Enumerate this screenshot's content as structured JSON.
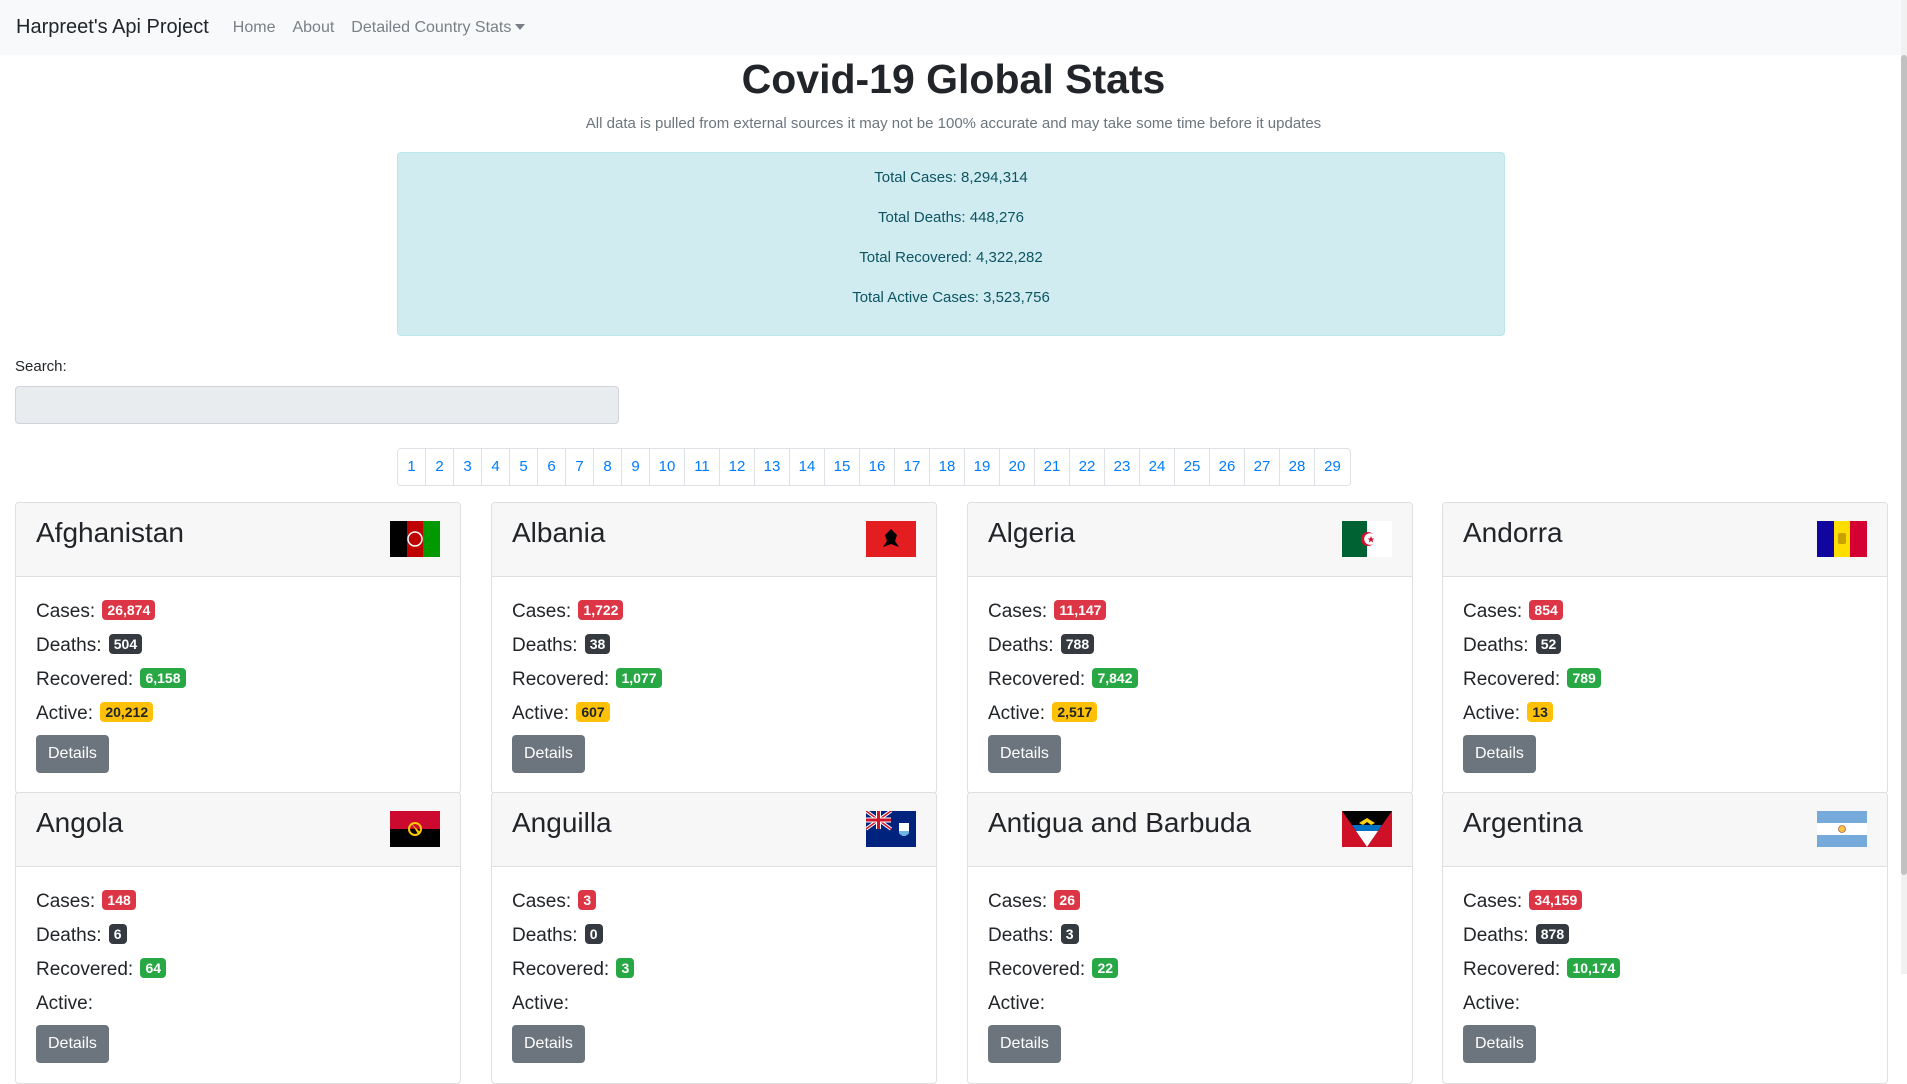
{
  "nav": {
    "brand": "Harpreet's Api Project",
    "links": [
      "Home",
      "About",
      "Detailed Country Stats"
    ]
  },
  "header": {
    "title": "Covid-19 Global Stats",
    "subtitle": "All data is pulled from external sources it may not be 100% accurate and may take some time before it updates"
  },
  "totals": {
    "cases": "Total Cases: 8,294,314",
    "deaths": "Total Deaths: 448,276",
    "recovered": "Total Recovered: 4,322,282",
    "active": "Total Active Cases: 3,523,756"
  },
  "search": {
    "label": "Search:",
    "value": ""
  },
  "pagination": [
    "1",
    "2",
    "3",
    "4",
    "5",
    "6",
    "7",
    "8",
    "9",
    "10",
    "11",
    "12",
    "13",
    "14",
    "15",
    "16",
    "17",
    "18",
    "19",
    "20",
    "21",
    "22",
    "23",
    "24",
    "25",
    "26",
    "27",
    "28",
    "29"
  ],
  "labels": {
    "cases": "Cases:",
    "deaths": "Deaths:",
    "recovered": "Recovered:",
    "active": "Active:",
    "details": "Details"
  },
  "colors": {
    "danger": "#dc3545",
    "dark": "#343a40",
    "success": "#28a745",
    "warning": "#ffc107",
    "info_bg": "#d1ecf1",
    "link": "#007bff"
  },
  "countries": [
    {
      "name": "Afghanistan",
      "flag": "afghanistan-flag",
      "cases": "26,874",
      "deaths": "504",
      "recovered": "6,158",
      "active": "20,212"
    },
    {
      "name": "Albania",
      "flag": "albania-flag",
      "cases": "1,722",
      "deaths": "38",
      "recovered": "1,077",
      "active": "607"
    },
    {
      "name": "Algeria",
      "flag": "algeria-flag",
      "cases": "11,147",
      "deaths": "788",
      "recovered": "7,842",
      "active": "2,517"
    },
    {
      "name": "Andorra",
      "flag": "andorra-flag",
      "cases": "854",
      "deaths": "52",
      "recovered": "789",
      "active": "13"
    },
    {
      "name": "Angola",
      "flag": "angola-flag",
      "cases": "148",
      "deaths": "6",
      "recovered": "64",
      "active": ""
    },
    {
      "name": "Anguilla",
      "flag": "anguilla-flag",
      "cases": "3",
      "deaths": "0",
      "recovered": "3",
      "active": ""
    },
    {
      "name": "Antigua and Barbuda",
      "flag": "antigua-and-barbuda-flag",
      "cases": "26",
      "deaths": "3",
      "recovered": "22",
      "active": ""
    },
    {
      "name": "Argentina",
      "flag": "argentina-flag",
      "cases": "34,159",
      "deaths": "878",
      "recovered": "10,174",
      "active": ""
    }
  ]
}
